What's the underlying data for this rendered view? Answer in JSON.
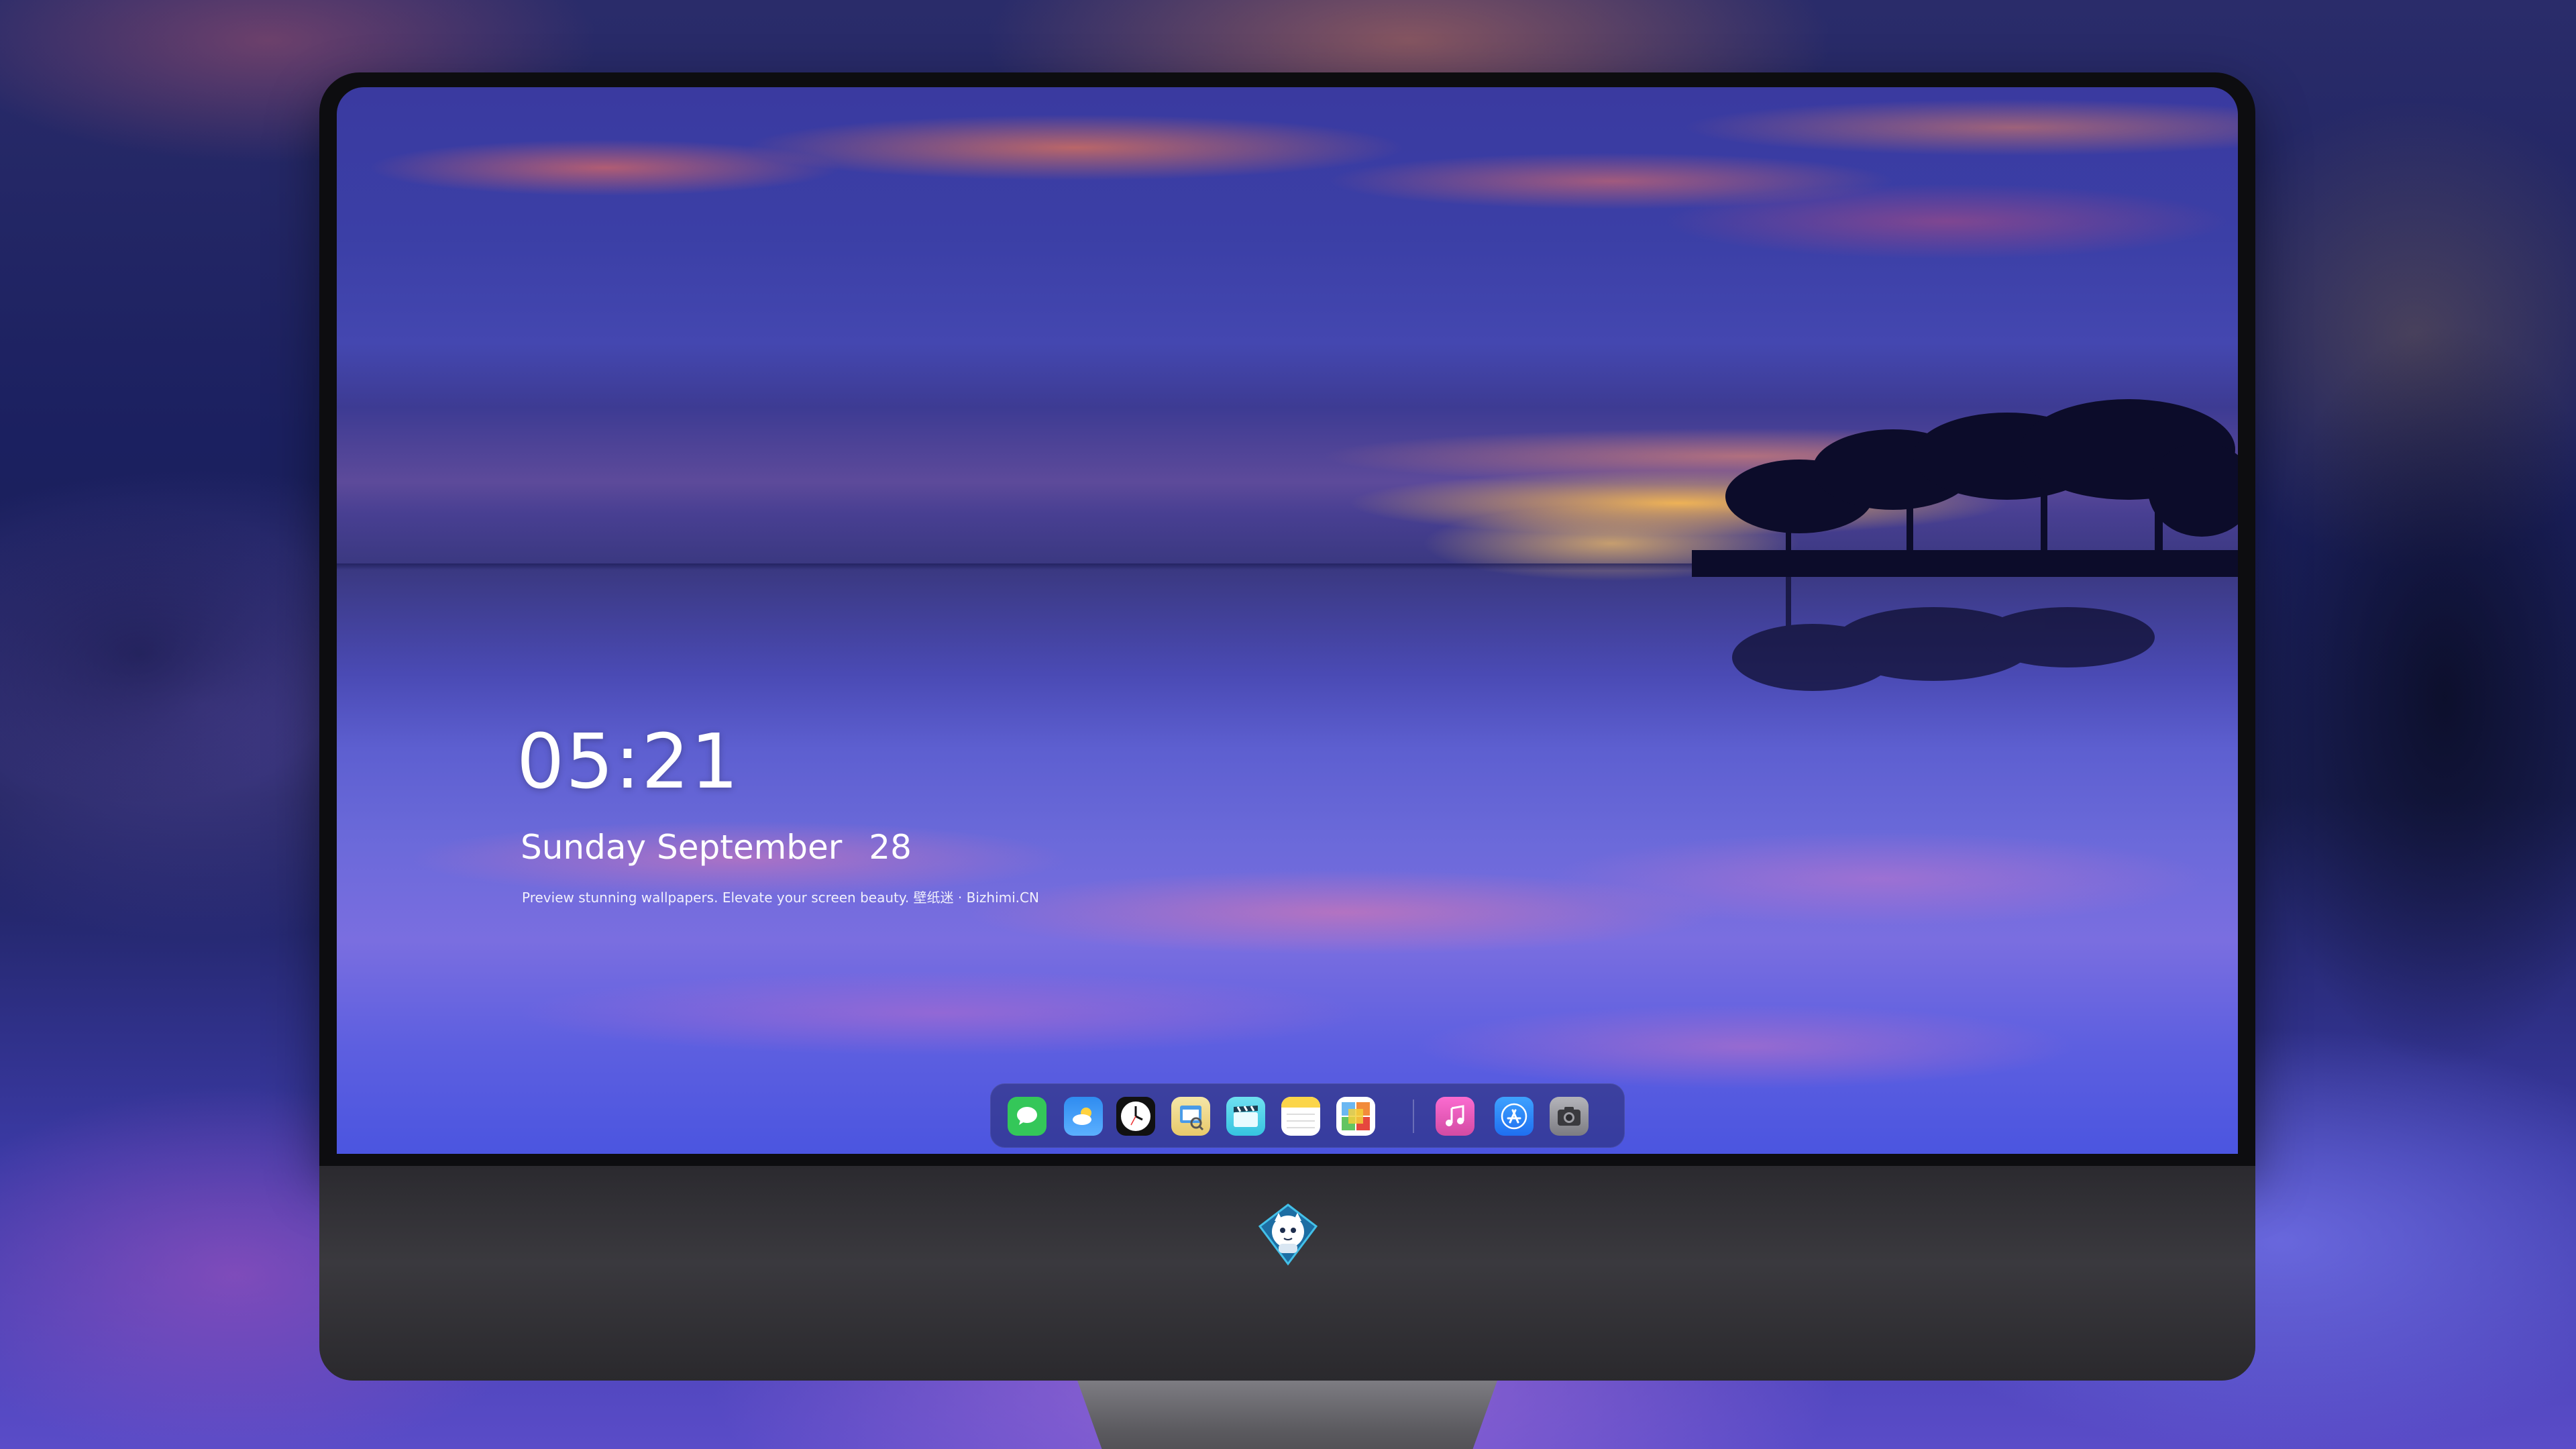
{
  "lock_screen": {
    "time": "05:21",
    "weekday": "Sunday",
    "month": "September",
    "day": "28",
    "caption": "Preview stunning wallpapers. Elevate your screen beauty. 壁纸迷 · Bizhimi.CN"
  },
  "dock": {
    "apps": [
      {
        "name": "messages-icon",
        "color": "#34c759"
      },
      {
        "name": "weather-icon",
        "color": "#2f8cf0"
      },
      {
        "name": "clock-icon",
        "color": "#111111"
      },
      {
        "name": "preview-icon",
        "color": "#e8c96a"
      },
      {
        "name": "clips-icon",
        "color": "#36c4e0"
      },
      {
        "name": "notes-icon",
        "color": "#fbd54a"
      },
      {
        "name": "photos-grid-icon",
        "color": "#6bb7f2"
      },
      {
        "name": "music-icon",
        "color": "#f05bb4"
      },
      {
        "name": "app-store-icon",
        "color": "#1f86ff"
      },
      {
        "name": "camera-icon",
        "color": "#8e8e93"
      }
    ]
  },
  "monitor": {
    "logo": "mascot-logo"
  }
}
